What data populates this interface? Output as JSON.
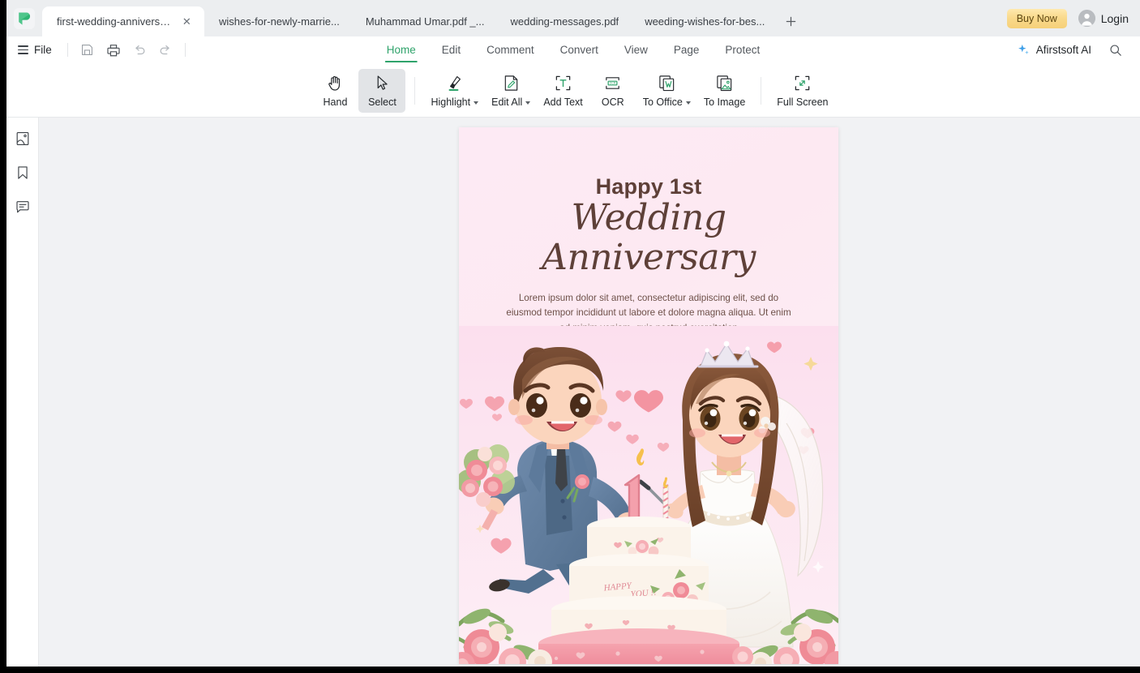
{
  "window": {
    "app_logo": "afirstsoft-logo"
  },
  "tabbar": {
    "tabs": [
      {
        "label": "first-wedding-anniversar...",
        "active": true,
        "closable": true
      },
      {
        "label": "wishes-for-newly-marrie...",
        "active": false,
        "closable": false
      },
      {
        "label": "Muhammad Umar.pdf _...",
        "active": false,
        "closable": false
      },
      {
        "label": "wedding-messages.pdf",
        "active": false,
        "closable": false
      },
      {
        "label": "weeding-wishes-for-bes...",
        "active": false,
        "closable": false
      }
    ],
    "new_tab_icon": "plus-icon",
    "buy_now_label": "Buy Now",
    "login_label": "Login"
  },
  "menubar": {
    "file_label": "File",
    "quick_actions": [
      {
        "name": "save-icon"
      },
      {
        "name": "print-icon"
      },
      {
        "name": "undo-icon"
      },
      {
        "name": "redo-icon"
      }
    ],
    "tabs": [
      {
        "label": "Home",
        "active": true
      },
      {
        "label": "Edit",
        "active": false
      },
      {
        "label": "Comment",
        "active": false
      },
      {
        "label": "Convert",
        "active": false
      },
      {
        "label": "View",
        "active": false
      },
      {
        "label": "Page",
        "active": false
      },
      {
        "label": "Protect",
        "active": false
      }
    ],
    "ai_label": "Afirstsoft AI",
    "search_icon": "search-icon"
  },
  "toolbar": {
    "tools": [
      {
        "label": "Hand",
        "icon": "hand-icon",
        "active": false,
        "dropdown": false
      },
      {
        "label": "Select",
        "icon": "cursor-icon",
        "active": true,
        "dropdown": false
      },
      {
        "label": "Highlight",
        "icon": "highlighter-icon",
        "active": false,
        "dropdown": true
      },
      {
        "label": "Edit All",
        "icon": "edit-page-icon",
        "active": false,
        "dropdown": true
      },
      {
        "label": "Add Text",
        "icon": "add-text-icon",
        "active": false,
        "dropdown": false
      },
      {
        "label": "OCR",
        "icon": "ocr-icon",
        "active": false,
        "dropdown": false
      },
      {
        "label": "To Office",
        "icon": "to-office-icon",
        "active": false,
        "dropdown": true
      },
      {
        "label": "To Image",
        "icon": "to-image-icon",
        "active": false,
        "dropdown": false
      },
      {
        "label": "Full Screen",
        "icon": "full-screen-icon",
        "active": false,
        "dropdown": false
      }
    ]
  },
  "sidebar": {
    "items": [
      {
        "name": "thumbnail-panel",
        "icon": "page-thumbnail-icon"
      },
      {
        "name": "bookmark-panel",
        "icon": "bookmark-icon"
      },
      {
        "name": "comment-panel",
        "icon": "comment-icon"
      }
    ]
  },
  "document": {
    "heading": "Happy 1st",
    "script_heading": "Wedding Anniversary",
    "body_text": "Lorem ipsum dolor sit amet, consectetur adipiscing elit, sed do eiusmod tempor incididunt ut labore et dolore magna aliqua. Ut enim ad minim veniam, quis nostrud exercitation",
    "illustration": "wedding-couple-with-cake-illustration",
    "cake_candle_number": "1",
    "cake_message": "HAPPY YOU !!",
    "page_background": "#fdeaf4"
  },
  "colors": {
    "accent_green": "#2fa36b",
    "buy_now_gold": "#f6d079",
    "tabbar_bg": "#eceef0",
    "canvas_bg": "#f1f2f4",
    "doc_text": "#5e4038"
  }
}
